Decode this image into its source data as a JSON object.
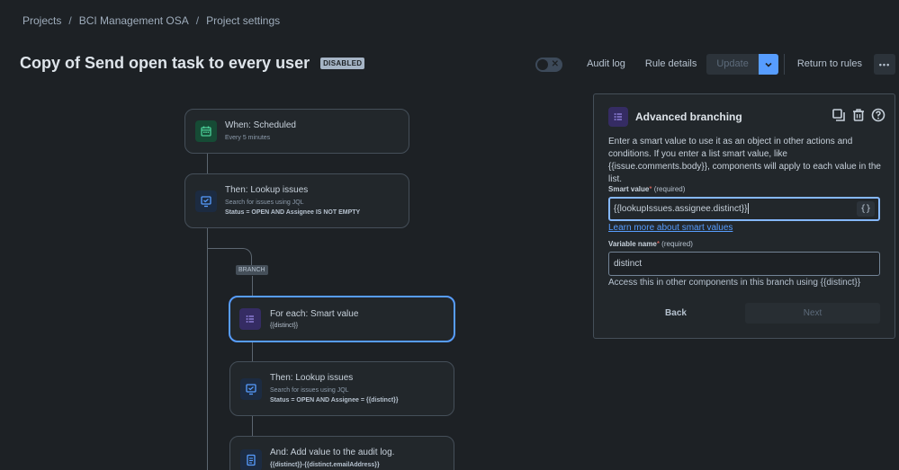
{
  "breadcrumb": {
    "items": [
      "Projects",
      "BCI Management OSA",
      "Project settings"
    ],
    "separator": "/"
  },
  "page": {
    "title": "Copy of Send open task to every user",
    "status_badge": "DISABLED"
  },
  "toolbar": {
    "toggle_enabled": false,
    "audit_log": "Audit log",
    "rule_details": "Rule details",
    "update": "Update",
    "return_to_rules": "Return to rules",
    "more": "•••"
  },
  "flow": {
    "trigger": {
      "title": "When: Scheduled",
      "subtitle": "Every 5 minutes",
      "icon": "calendar-icon"
    },
    "lookup": {
      "title": "Then: Lookup issues",
      "subtitle": "Search for issues using JQL",
      "detail": "Status = OPEN AND Assignee IS NOT EMPTY",
      "icon": "search-icon"
    },
    "branch_label": "BRANCH",
    "for_each": {
      "title": "For each: Smart value",
      "subtitle": "{{distinct}}",
      "icon": "list-icon"
    },
    "lookup2": {
      "title": "Then: Lookup issues",
      "subtitle": "Search for issues using JQL",
      "detail": "Status = OPEN AND Assignee = {{distinct}}",
      "icon": "search-icon"
    },
    "audit": {
      "title": "And: Add value to the audit log.",
      "subtitle": "{{distinct}}-{{distinct.emailAddress}}",
      "icon": "document-icon"
    }
  },
  "panel": {
    "title": "Advanced branching",
    "description": "Enter a smart value to use it as an object in other actions and conditions. If you enter a list smart value, like {{issue.comments.body}}, components will apply to each value in the list.",
    "smart_value_label": "Smart value",
    "required_text": "(required)",
    "smart_value": "{{lookupIssues.assignee.distinct}}",
    "learn_more": "Learn more about smart values",
    "variable_name_label": "Variable name",
    "variable_name": "distinct",
    "hint": "Access this in other components in this branch using {{distinct}}",
    "back": "Back",
    "next": "Next"
  },
  "colors": {
    "background": "#1d2125",
    "accent": "#579dff",
    "card_border": "#454f59",
    "trigger_icon_bg": "#164b35",
    "action_icon_bg": "#1c2b41",
    "branch_icon_bg": "#352c63"
  }
}
